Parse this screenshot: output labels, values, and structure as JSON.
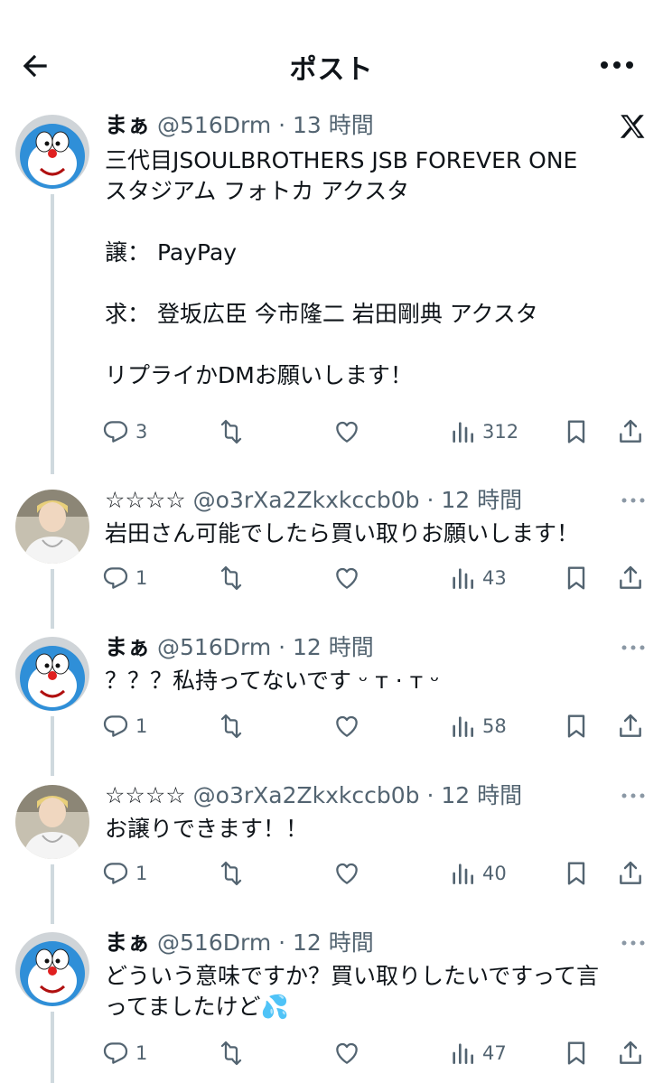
{
  "header": {
    "title": "ポスト"
  },
  "tweets": [
    {
      "name": "まぁ",
      "meta": "@516Drm · 13 時間",
      "text": "三代目JSOULBROTHERS JSB FOREVER ONE\nスタジアム フォトカ アクスタ\n\n譲： PayPay\n\n求： 登坂広臣 今市隆二 岩田剛典 アクスタ\n\nリプライかDMお願いします！",
      "replies": "3",
      "views": "312"
    },
    {
      "name": "☆☆☆☆",
      "meta": "@o3rXa2Zkxkccb0b · 12 時間",
      "text": "岩田さん可能でしたら買い取りお願いします！",
      "replies": "1",
      "views": "43"
    },
    {
      "name": "まぁ",
      "meta": "@516Drm · 12 時間",
      "text": "？？？私持ってないです ᵕ ᴛ · ᴛ ᵕ",
      "replies": "1",
      "views": "58"
    },
    {
      "name": "☆☆☆☆",
      "meta": "@o3rXa2Zkxkccb0b · 12 時間",
      "text": "お譲りできます！！",
      "replies": "1",
      "views": "40"
    },
    {
      "name": "まぁ",
      "meta": "@516Drm · 12 時間",
      "text": "どういう意味ですか？買い取りしたいですって言\nってましたけど💦",
      "replies": "1",
      "views": "47"
    }
  ],
  "icons": {
    "back": "arrow-left-icon",
    "more": "more-horizontal-icon",
    "x": "x-logo-icon",
    "reply": "reply-icon",
    "retweet": "retweet-icon",
    "like": "heart-icon",
    "views": "views-icon",
    "bookmark": "bookmark-icon",
    "share": "share-icon"
  },
  "colors": {
    "text": "#0f1419",
    "secondary": "#536471",
    "thread": "#cfd9de",
    "accent": "#1d9bf0"
  }
}
